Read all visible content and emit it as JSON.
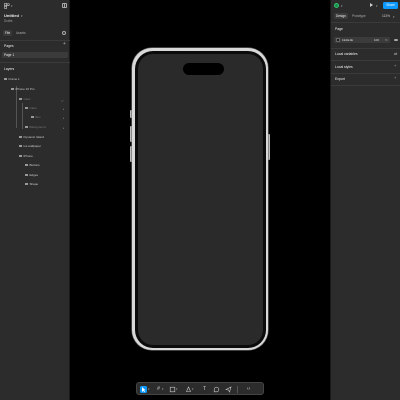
{
  "file": {
    "name": "Untitled",
    "subtitle": "Drafts"
  },
  "left_tabs": [
    "File",
    "Assets"
  ],
  "pages": {
    "heading": "Pages",
    "items": [
      "Page 1"
    ]
  },
  "layers": {
    "heading": "Layers",
    "items": [
      {
        "label": "Frame 1",
        "depth": 0
      },
      {
        "label": "iPhone 16 Pro",
        "depth": 1
      },
      {
        "label": "Glow",
        "depth": 2,
        "dim": true
      },
      {
        "label": "Glare",
        "depth": 3,
        "dim": true
      },
      {
        "label": "Box",
        "depth": 4,
        "dim": true
      },
      {
        "label": "Background",
        "depth": 3,
        "dim": true
      },
      {
        "label": "Dynamic Island",
        "depth": 2
      },
      {
        "label": "ios wallpaper",
        "depth": 2
      },
      {
        "label": "iPhone",
        "depth": 2
      },
      {
        "label": "Buttons",
        "depth": 3
      },
      {
        "label": "Edges",
        "depth": 3
      },
      {
        "label": "Shape",
        "depth": 3
      }
    ]
  },
  "right": {
    "share_label": "Share",
    "tabs": [
      "Design",
      "Prototype"
    ],
    "zoom": "113%",
    "page_heading": "Page",
    "page_color_hex": "1E1E1E",
    "page_opacity": "100",
    "page_opacity_unit": "%",
    "sections": [
      "Local variables",
      "Local styles",
      "Export"
    ]
  },
  "colors": {
    "accent": "#0d99ff",
    "panel": "#2c2c2c",
    "canvas": "#000000",
    "page_fill": "#1E1E1E"
  },
  "toolbar": {
    "tools": [
      "move-tool",
      "frame-tool",
      "shape-tool",
      "pen-tool",
      "text-tool",
      "comment-tool",
      "actions-tool",
      "dev-mode-tool"
    ]
  }
}
